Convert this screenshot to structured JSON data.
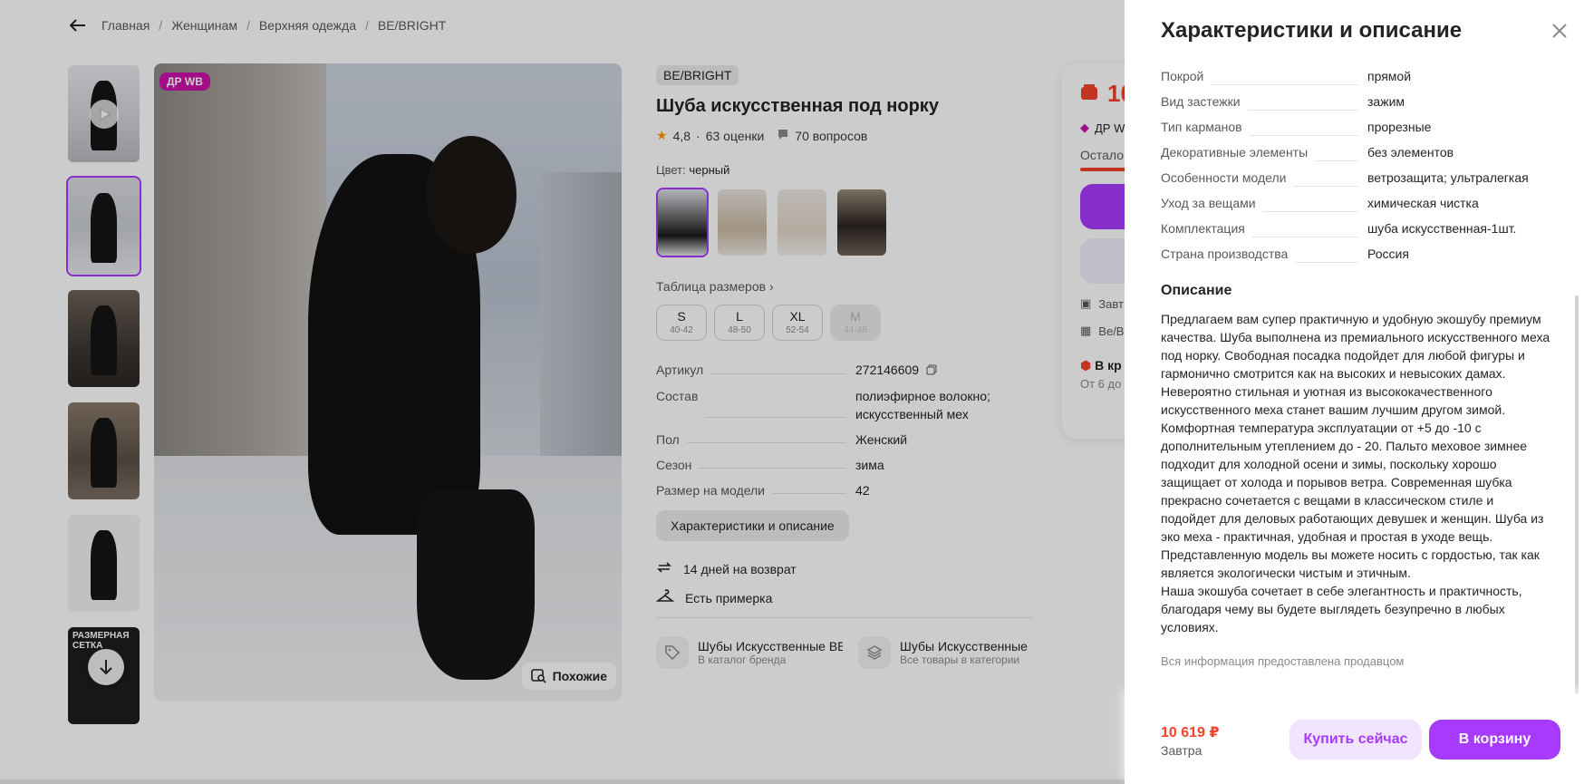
{
  "breadcrumb": {
    "items": [
      "Главная",
      "Женщинам",
      "Верхняя одежда",
      "BE/BRIGHT"
    ],
    "separator": "/"
  },
  "gallery": {
    "size_grid_label": "РАЗМЕРНАЯ СЕТКА",
    "badge": "ДР WB",
    "similar_label": "Похожие"
  },
  "product": {
    "brand": "BE/BRIGHT",
    "title": "Шуба искусственная под норку",
    "rating": "4,8",
    "reviews": "63 оценки",
    "questions": "70 вопросов",
    "color_label": "Цвет:",
    "color_value": "черный",
    "size_table_label": "Таблица размеров",
    "sizes": [
      {
        "size": "S",
        "range": "40-42",
        "available": true
      },
      {
        "size": "L",
        "range": "48-50",
        "available": true
      },
      {
        "size": "XL",
        "range": "52-54",
        "available": true
      },
      {
        "size": "M",
        "range": "44-46",
        "available": false
      }
    ],
    "attributes": [
      {
        "key": "Артикул",
        "value": "272146609"
      },
      {
        "key": "Состав",
        "value": "полиэфирное волокно; искусственный мех"
      },
      {
        "key": "Пол",
        "value": "Женский"
      },
      {
        "key": "Сезон",
        "value": "зима"
      },
      {
        "key": "Размер на модели",
        "value": "42"
      }
    ],
    "chars_button": "Характеристики и описание",
    "perks": [
      "14 дней на возврат",
      "Есть примерка"
    ],
    "brand_links": [
      {
        "title": "Шубы Искусственные BE/BRIGHT",
        "subtitle": "В каталог бренда"
      },
      {
        "title": "Шубы Искусственные",
        "subtitle": "Все товары в категории"
      }
    ]
  },
  "price_card": {
    "price_partial": "10",
    "badge_partial": "ДР W",
    "left_partial": "Остало",
    "delivery_partial": "Завт",
    "seller_partial": "Be/B",
    "stock_partial": "В кр",
    "stock_sub_partial": "От 6 до"
  },
  "drawer": {
    "title": "Характеристики и описание",
    "specs": [
      {
        "key": "Покрой",
        "value": "прямой"
      },
      {
        "key": "Вид застежки",
        "value": "зажим"
      },
      {
        "key": "Тип карманов",
        "value": "прорезные"
      },
      {
        "key": "Декоративные элементы",
        "value": "без элементов"
      },
      {
        "key": "Особенности модели",
        "value": "ветрозащита; ультралегкая"
      },
      {
        "key": "Уход за вещами",
        "value": "химическая чистка"
      },
      {
        "key": "Комплектация",
        "value": "шуба искусственная-1шт."
      },
      {
        "key": "Страна производства",
        "value": "Россия"
      }
    ],
    "description_title": "Описание",
    "description": "Предлагаем вам супер практичную и удобную экошубу премиум качества. Шуба выполнена из премиального искусственного меха под норку. Свободная посадка подойдет для любой фигуры и гармонично смотрится как на высоких и невысоких дамах. Невероятно стильная и уютная из высококачественного искусственного меха станет вашим лучшим другом зимой. Комфортная температура эксплуатации от +5 до -10 с дополнительным утеплением до - 20. Пальто меховое зимнее подходит для холодной осени и зимы, поскольку хорошо защищает от холода и порывов ветра. Современная шубка прекрасно сочетается с вещами в классическом стиле и подойдет для деловых работающих девушек и женщин. Шуба из эко меха - практичная, удобная и простая в уходе вещь. Представленную модель вы можете носить с гордостью, так как является экологически чистым и этичным.\nНаша экошуба сочетает в себе элегантность и практичность, благодаря чему вы будете выглядеть безупречно в любых условиях.",
    "note": "Вся информация предоставлена продавцом",
    "footer": {
      "price": "10 619 ₽",
      "when": "Завтра",
      "buy_now": "Купить сейчас",
      "add_to_cart": "В корзину"
    }
  },
  "colors": {
    "accent": "#a73afd",
    "price": "#f4432c",
    "badge": "#cb11ab"
  }
}
